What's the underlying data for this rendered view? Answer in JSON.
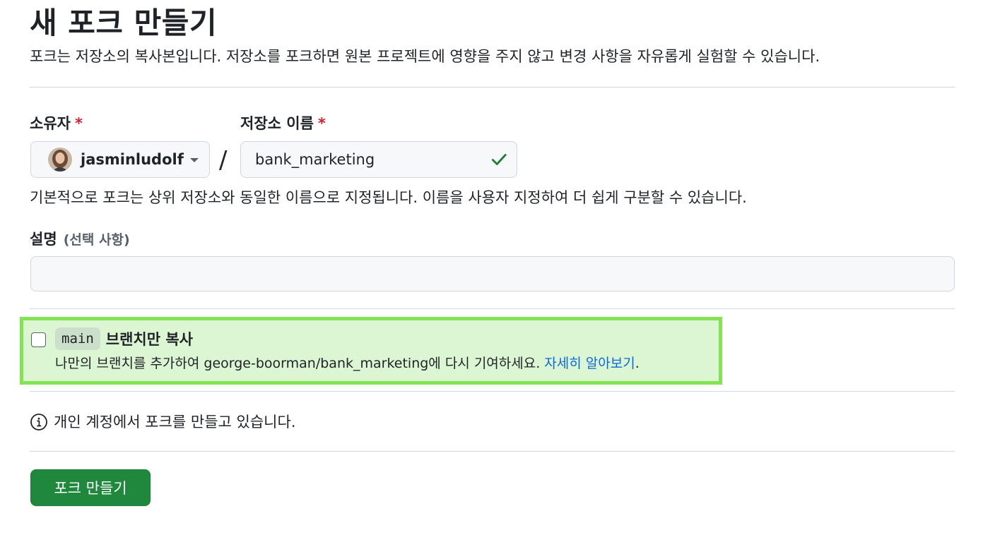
{
  "page": {
    "title": "새 포크 만들기",
    "subtitle": "포크는 저장소의 복사본입니다. 저장소를 포크하면 원본 프로젝트에 영향을 주지 않고 변경 사항을 자유롭게 실험할 수 있습니다."
  },
  "owner": {
    "label": "소유자",
    "required_mark": "*",
    "value": "jasminludolf",
    "icon": "avatar"
  },
  "separator": "/",
  "repo_name": {
    "label": "저장소 이름",
    "required_mark": "*",
    "value": "bank_marketing",
    "status_icon": "check-icon",
    "status_color": "#1a7f37"
  },
  "repo_hint": "기본적으로 포크는 상위 저장소와 동일한 이름으로 지정됩니다. 이름을 사용자 지정하여 더 쉽게 구분할 수 있습니다.",
  "description": {
    "label": "설명",
    "optional_label": "(선택 사항)",
    "value": ""
  },
  "copy_branch": {
    "checked": false,
    "branch": "main",
    "label": "브랜치만 복사",
    "desc_before": "나만의 브랜치를 추가하여 george-boorman/bank_marketing에 다시 기여하세요. ",
    "link_text": "자세히 알아보기",
    "desc_after": "."
  },
  "info": {
    "icon": "info-icon",
    "text": "개인 계정에서 포크를 만들고 있습니다."
  },
  "submit": {
    "label": "포크 만들기",
    "color": "#1f883d"
  },
  "colors": {
    "highlight_fill": "#dcf5d2",
    "highlight_border": "#84e353",
    "required": "#cf222e",
    "link": "#0969da"
  }
}
